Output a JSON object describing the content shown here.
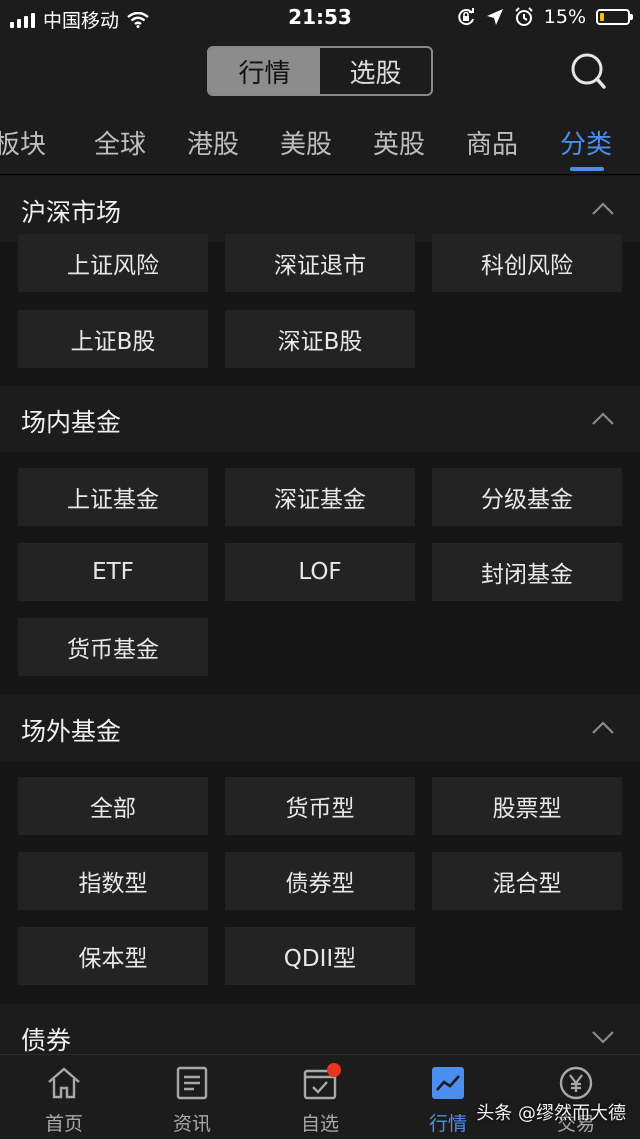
{
  "status_bar": {
    "carrier": "中国移动",
    "time": "21:53",
    "battery_percent": "15%",
    "battery_level": 0.15
  },
  "header": {
    "segments": [
      {
        "label": "行情",
        "active": true
      },
      {
        "label": "选股",
        "active": false
      }
    ],
    "search_icon": "search-icon"
  },
  "tabs": [
    {
      "label": "板块"
    },
    {
      "label": "全球"
    },
    {
      "label": "港股"
    },
    {
      "label": "美股"
    },
    {
      "label": "英股"
    },
    {
      "label": "商品"
    },
    {
      "label": "分类",
      "active": true
    }
  ],
  "sections": [
    {
      "title": "沪深市场",
      "expanded": true,
      "items": [
        "上证风险",
        "深证退市",
        "科创风险",
        "上证B股",
        "深证B股"
      ]
    },
    {
      "title": "场内基金",
      "expanded": true,
      "items": [
        "上证基金",
        "深证基金",
        "分级基金",
        "ETF",
        "LOF",
        "封闭基金",
        "货币基金"
      ]
    },
    {
      "title": "场外基金",
      "expanded": true,
      "items": [
        "全部",
        "货币型",
        "股票型",
        "指数型",
        "债券型",
        "混合型",
        "保本型",
        "QDII型"
      ]
    },
    {
      "title": "债券",
      "expanded": false,
      "items": []
    }
  ],
  "bottom_nav": [
    {
      "label": "首页",
      "icon": "home-icon"
    },
    {
      "label": "资讯",
      "icon": "news-icon"
    },
    {
      "label": "自选",
      "icon": "watchlist-icon",
      "badge": true
    },
    {
      "label": "行情",
      "icon": "market-chart-icon",
      "active": true
    },
    {
      "label": "交易",
      "icon": "yuan-icon"
    }
  ],
  "watermark": "头条 @缪然而大德",
  "colors": {
    "accent": "#4a8ff0",
    "background": "#161616",
    "cell": "#232323",
    "badge": "#e8331f"
  }
}
